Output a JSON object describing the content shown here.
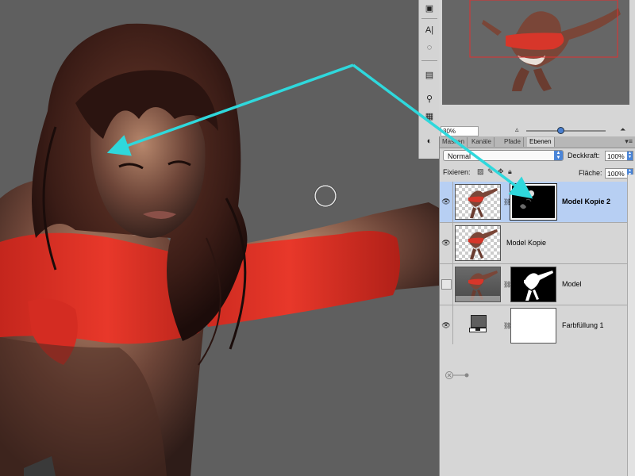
{
  "tools": [
    {
      "icon": "save-icon",
      "glyph": "▣"
    },
    {
      "icon": "character-panel-icon",
      "glyph": "A|"
    },
    {
      "icon": "rotate-view-icon",
      "glyph": "◌"
    },
    {
      "icon": "metadata-icon",
      "glyph": "▤"
    },
    {
      "icon": "clone-source-icon",
      "glyph": "⚲"
    },
    {
      "icon": "grid-icon",
      "glyph": "▦"
    },
    {
      "icon": "histogram-icon",
      "glyph": "◐"
    }
  ],
  "navigator": {
    "zoom": "30%",
    "zoom_level": 0.43
  },
  "layers_panel": {
    "tabs": [
      {
        "label": "Masken"
      },
      {
        "label": "Kanäle"
      },
      {
        "label": "Pfade"
      },
      {
        "label": "Ebenen"
      }
    ],
    "blend_mode": "Normal",
    "opacity_label": "Deckkraft:",
    "opacity_value": "100%",
    "lock_label": "Fixieren:",
    "fill_label": "Fläche:",
    "fill_value": "100%",
    "layers": [
      {
        "name": "Model Kopie 2",
        "visible": true,
        "selected": true,
        "has_mask": true
      },
      {
        "name": "Model Kopie",
        "visible": true,
        "selected": false,
        "has_mask": false
      },
      {
        "name": "Model",
        "visible": false,
        "selected": false,
        "has_mask": true
      },
      {
        "name": "Farbfüllung 1",
        "visible": true,
        "selected": false,
        "has_mask": true
      }
    ]
  },
  "colors": {
    "canvas_bg": "#5f5f5f",
    "annotation": "#2fd8dc",
    "selection": "#b7cff3",
    "accent": "#4a85d8"
  }
}
